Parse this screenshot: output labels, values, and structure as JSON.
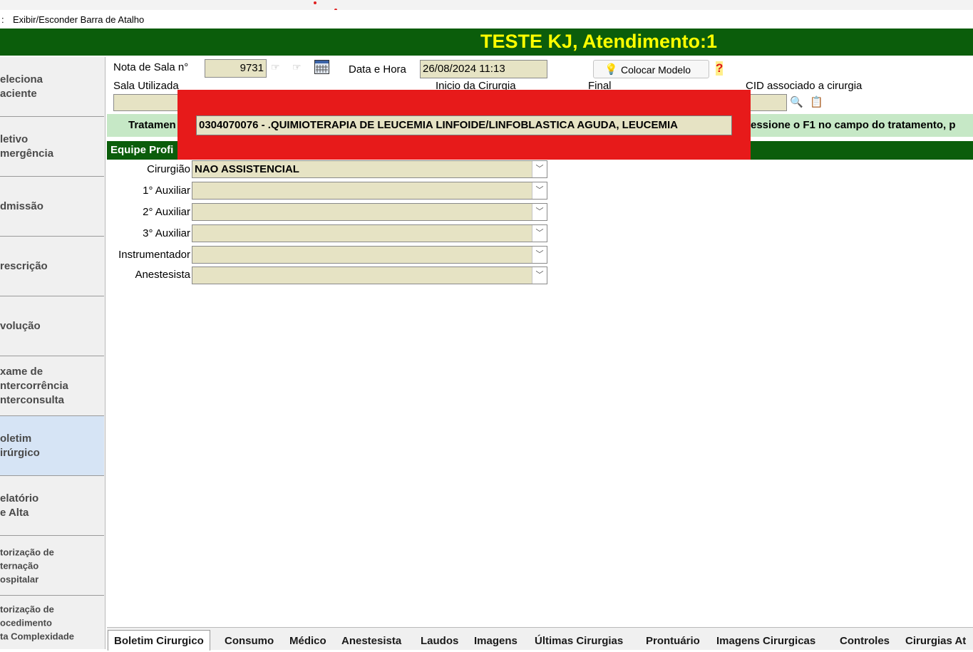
{
  "menu": {
    "toggle_label": "Exibir/Esconder Barra de Atalho"
  },
  "header": {
    "title": "TESTE KJ, Atendimento:1"
  },
  "sidebar": {
    "items": [
      {
        "label": "eleciona\naciente"
      },
      {
        "label": "letivo\nmergência"
      },
      {
        "label": "dmissão"
      },
      {
        "label": "rescrição"
      },
      {
        "label": "volução"
      },
      {
        "label": "xame de\nntercorrência\nnterconsulta"
      },
      {
        "label": "oletim\nirúrgico"
      },
      {
        "label": "elatório\ne Alta"
      },
      {
        "label": "torização de\nternação\nospitalar"
      },
      {
        "label": "torização de\nocedimento\nta Complexidade"
      }
    ]
  },
  "form": {
    "nota_label": "Nota de Sala n°",
    "nota_value": "9731",
    "data_hora_label": "Data e Hora",
    "data_hora_value": "26/08/2024 11:13",
    "colocar_modelo_label": "Colocar Modelo",
    "help_symbol": "?",
    "sala_label": "Sala Utilizada",
    "inicio_label": "Inicio da Cirurgia",
    "final_label": "Final",
    "cid_label": "CID associado a cirurgia",
    "tratamento_label": "Tratamen",
    "tratamento_hint": "essione o F1 no campo do tratamento, p",
    "equipe_label": "Equipe Profi",
    "tratamento_value": "0304070076 - .QUIMIOTERAPIA DE LEUCEMIA LINFOIDE/LINFOBLASTICA AGUDA, LEUCEMIA"
  },
  "team": [
    {
      "label": "Cirurgião",
      "value": "NAO ASSISTENCIAL"
    },
    {
      "label": "1° Auxiliar",
      "value": ""
    },
    {
      "label": "2° Auxiliar",
      "value": ""
    },
    {
      "label": "3° Auxiliar",
      "value": ""
    },
    {
      "label": "Instrumentador",
      "value": ""
    },
    {
      "label": "Anestesista",
      "value": ""
    }
  ],
  "tabs": [
    {
      "label": "Boletim Cirurgico",
      "active": true
    },
    {
      "label": "Consumo"
    },
    {
      "label": "Médico"
    },
    {
      "label": "Anestesista"
    },
    {
      "label": "Laudos"
    },
    {
      "label": "Imagens"
    },
    {
      "label": "Últimas Cirurgias"
    },
    {
      "label": "Prontuário"
    },
    {
      "label": "Imagens Cirurgicas"
    },
    {
      "label": "Controles"
    },
    {
      "label": "Cirurgias At"
    }
  ],
  "colors": {
    "header_bg": "#0b5d0b",
    "header_text": "#ffff00",
    "field_bg": "#e6e3c4",
    "highlight": "#e71a1a",
    "band_green": "#c6e8c6"
  }
}
